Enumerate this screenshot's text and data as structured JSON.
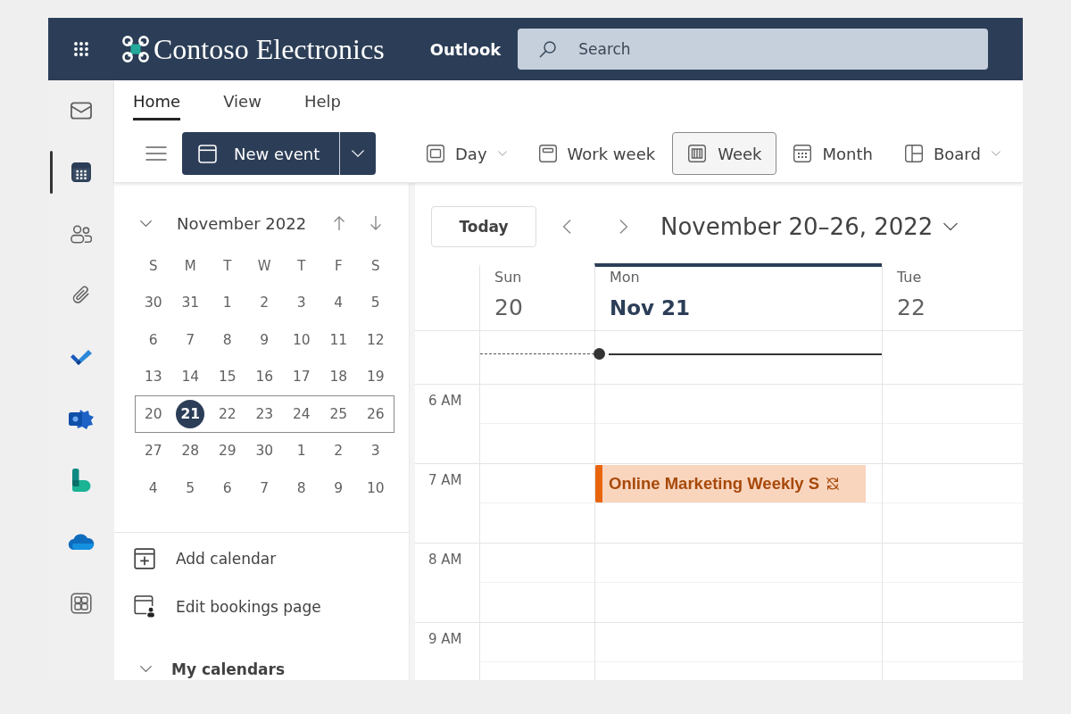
{
  "app_bar": {
    "brand": "Contoso Electronics",
    "app_name": "Outlook",
    "search": {
      "placeholder": "Search"
    }
  },
  "rail": [
    {
      "kind": "mail",
      "selected": false
    },
    {
      "kind": "calendar",
      "selected": true
    },
    {
      "kind": "people",
      "selected": false
    },
    {
      "kind": "files",
      "selected": false
    },
    {
      "kind": "todo",
      "selected": false
    },
    {
      "kind": "yammer",
      "selected": false
    },
    {
      "kind": "bookings",
      "selected": false
    },
    {
      "kind": "onedrive",
      "selected": false
    },
    {
      "kind": "apps",
      "selected": false
    }
  ],
  "ribbon": {
    "tabs": [
      {
        "label": "Home",
        "selected": true
      },
      {
        "label": "View",
        "selected": false
      },
      {
        "label": "Help",
        "selected": false
      }
    ],
    "new_event": {
      "label": "New event"
    },
    "views": [
      {
        "kind": "day",
        "label": "Day",
        "selected": false,
        "menu": true
      },
      {
        "kind": "work_week",
        "label": "Work week",
        "selected": false,
        "menu": false
      },
      {
        "kind": "week",
        "label": "Week",
        "selected": true,
        "menu": false
      },
      {
        "kind": "month",
        "label": "Month",
        "selected": false,
        "menu": false
      },
      {
        "kind": "board",
        "label": "Board",
        "selected": false,
        "menu": true
      }
    ]
  },
  "mini_calendar": {
    "title": "November 2022",
    "expanded": true,
    "weekdays": [
      "S",
      "M",
      "T",
      "W",
      "T",
      "F",
      "S"
    ],
    "weeks": [
      {
        "days": [
          {
            "label": "30",
            "selected": false
          },
          {
            "label": "31",
            "selected": false
          },
          {
            "label": "1",
            "selected": false
          },
          {
            "label": "2",
            "selected": false
          },
          {
            "label": "3",
            "selected": false
          },
          {
            "label": "4",
            "selected": false
          },
          {
            "label": "5",
            "selected": false
          }
        ]
      },
      {
        "days": [
          {
            "label": "6",
            "selected": false
          },
          {
            "label": "7",
            "selected": false
          },
          {
            "label": "8",
            "selected": false
          },
          {
            "label": "9",
            "selected": false
          },
          {
            "label": "10",
            "selected": false
          },
          {
            "label": "11",
            "selected": false
          },
          {
            "label": "12",
            "selected": false
          }
        ]
      },
      {
        "days": [
          {
            "label": "13",
            "selected": false
          },
          {
            "label": "14",
            "selected": false
          },
          {
            "label": "15",
            "selected": false
          },
          {
            "label": "16",
            "selected": false
          },
          {
            "label": "17",
            "selected": false
          },
          {
            "label": "18",
            "selected": false
          },
          {
            "label": "19",
            "selected": false
          }
        ]
      },
      {
        "days": [
          {
            "label": "20",
            "selected": false
          },
          {
            "label": "21",
            "selected": true
          },
          {
            "label": "22",
            "selected": false
          },
          {
            "label": "23",
            "selected": false
          },
          {
            "label": "24",
            "selected": false
          },
          {
            "label": "25",
            "selected": false
          },
          {
            "label": "26",
            "selected": false
          }
        ]
      },
      {
        "days": [
          {
            "label": "27",
            "selected": false
          },
          {
            "label": "28",
            "selected": false
          },
          {
            "label": "29",
            "selected": false
          },
          {
            "label": "30",
            "selected": false
          },
          {
            "label": "1",
            "selected": false
          },
          {
            "label": "2",
            "selected": false
          },
          {
            "label": "3",
            "selected": false
          }
        ]
      },
      {
        "days": [
          {
            "label": "4",
            "selected": false
          },
          {
            "label": "5",
            "selected": false
          },
          {
            "label": "6",
            "selected": false
          },
          {
            "label": "7",
            "selected": false
          },
          {
            "label": "8",
            "selected": false
          },
          {
            "label": "9",
            "selected": false
          },
          {
            "label": "10",
            "selected": false
          }
        ]
      }
    ]
  },
  "nav_links": [
    {
      "kind": "add_calendar",
      "label": "Add calendar"
    },
    {
      "kind": "bookings_page",
      "label": "Edit bookings page"
    }
  ],
  "my_calendars": {
    "label": "My calendars",
    "expanded": true
  },
  "calendar": {
    "today_button": "Today",
    "range_title": "November 20–26, 2022",
    "days": [
      {
        "weekday": "Sun",
        "date": "20",
        "selected": false
      },
      {
        "weekday": "Mon",
        "date": "Nov 21",
        "selected": true
      },
      {
        "weekday": "Tue",
        "date": "22",
        "selected": false
      }
    ],
    "hours": [
      {
        "label": "6 AM",
        "cells": [
          {
            "kind": "free"
          },
          {
            "kind": "free"
          },
          {
            "kind": "free"
          }
        ]
      },
      {
        "label": "7 AM",
        "cells": [
          {
            "kind": "free"
          },
          {
            "kind": "event",
            "title": "Online Marketing Weekly S",
            "color": "#e8650e",
            "exception": true
          },
          {
            "kind": "free"
          }
        ]
      },
      {
        "label": "8 AM",
        "cells": [
          {
            "kind": "free"
          },
          {
            "kind": "free"
          },
          {
            "kind": "free"
          }
        ]
      },
      {
        "label": "9 AM",
        "cells": [
          {
            "kind": "free"
          },
          {
            "kind": "free"
          },
          {
            "kind": "free"
          }
        ]
      }
    ]
  }
}
